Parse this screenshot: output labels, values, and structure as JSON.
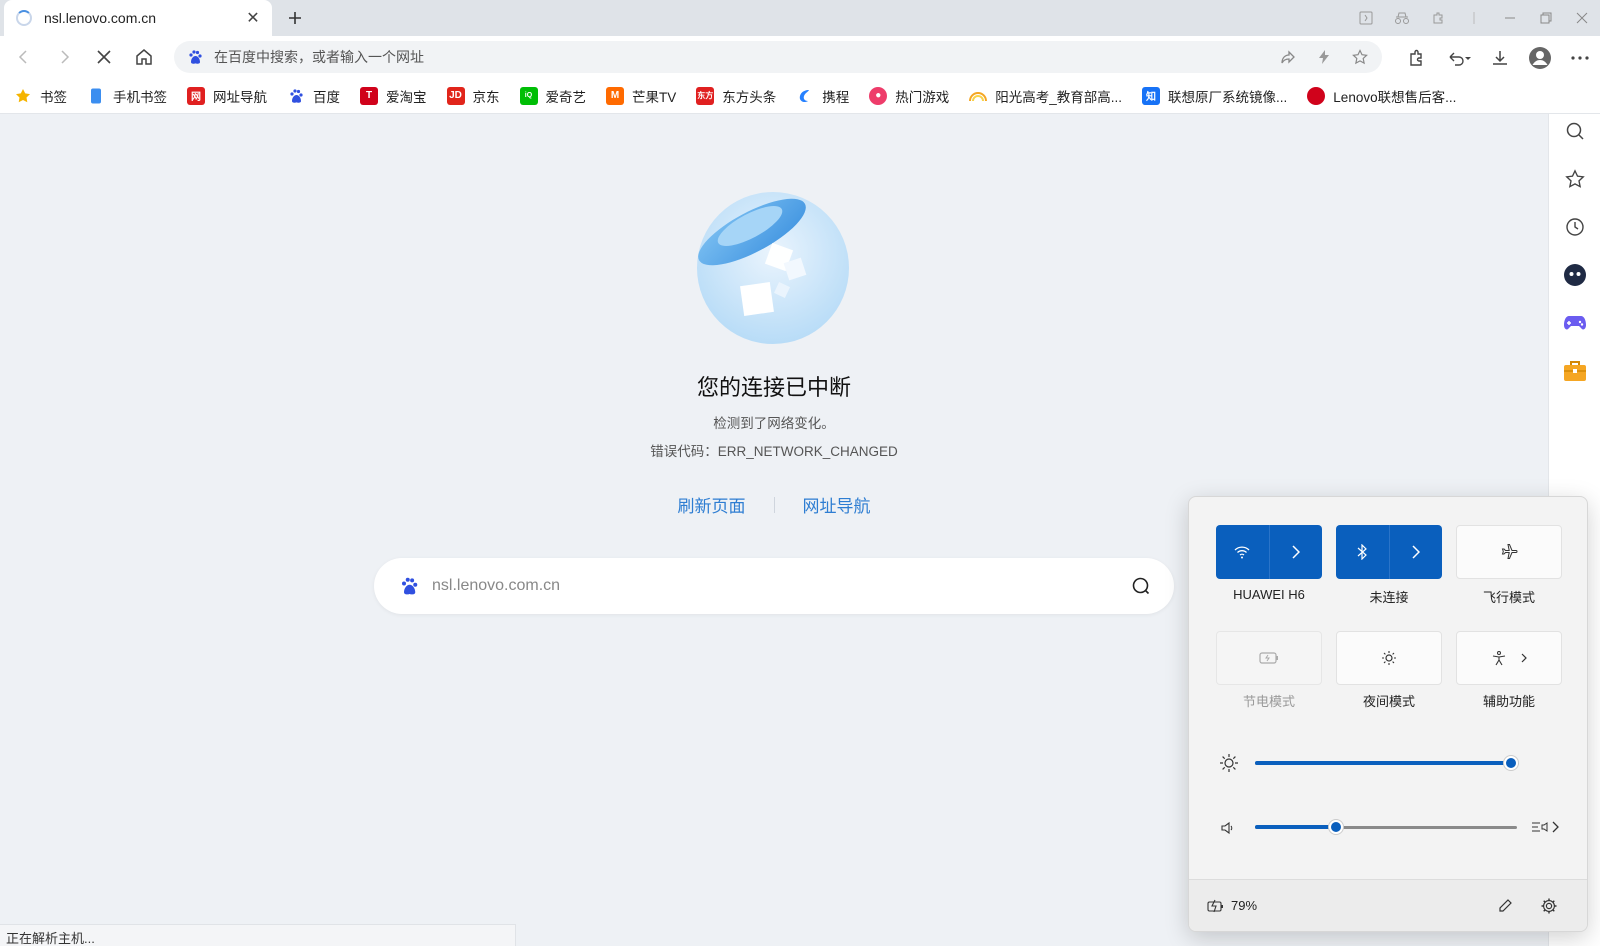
{
  "tab": {
    "title": "nsl.lenovo.com.cn",
    "loading": true
  },
  "toolbar": {
    "omnibox_placeholder": "在百度中搜索，或者输入一个网址"
  },
  "bookmarks": [
    {
      "label": "书签",
      "icon": "star-icon",
      "color": "#f5b400"
    },
    {
      "label": "手机书签",
      "icon": "phone-icon",
      "color": "#3b8ef0"
    },
    {
      "label": "网址导航",
      "icon": "nav-icon",
      "color": "#e02020"
    },
    {
      "label": "百度",
      "icon": "baidu-paw-icon",
      "color": "#3050e0"
    },
    {
      "label": "爱淘宝",
      "icon": "taobao-icon",
      "color": "#d0021b"
    },
    {
      "label": "京东",
      "icon": "jd-icon",
      "color": "#e1251b"
    },
    {
      "label": "爱奇艺",
      "icon": "iqiyi-icon",
      "color": "#00be06"
    },
    {
      "label": "芒果TV",
      "icon": "mango-icon",
      "color": "#ff6a00"
    },
    {
      "label": "东方头条",
      "icon": "dftt-icon",
      "color": "#e02020"
    },
    {
      "label": "携程",
      "icon": "ctrip-icon",
      "color": "#2681ff"
    },
    {
      "label": "热门游戏",
      "icon": "game-icon",
      "color": "#ee3c6a"
    },
    {
      "label": "阳光高考_教育部高...",
      "icon": "rainbow-icon",
      "color": "#f5a623"
    },
    {
      "label": "联想原厂系统镜像...",
      "icon": "zhihu-icon",
      "color": "#1772f6"
    },
    {
      "label": "Lenovo联想售后客...",
      "icon": "lenovo-icon",
      "color": "#d0021b"
    }
  ],
  "error": {
    "title": "您的连接已中断",
    "description": "检测到了网络变化。",
    "code": "错误代码：ERR_NETWORK_CHANGED",
    "refresh_link": "刷新页面",
    "nav_link": "网址导航",
    "search_value": "nsl.lenovo.com.cn"
  },
  "status_bar": "正在解析主机...",
  "quick_settings": {
    "tiles": [
      {
        "label": "HUAWEI H6",
        "icon": "wifi-icon",
        "state": "on"
      },
      {
        "label": "未连接",
        "icon": "bluetooth-icon",
        "state": "on"
      },
      {
        "label": "飞行模式",
        "icon": "airplane-icon",
        "state": "off"
      },
      {
        "label": "节电模式",
        "icon": "battery-saver-icon",
        "state": "disabled"
      },
      {
        "label": "夜间模式",
        "icon": "night-light-icon",
        "state": "off"
      },
      {
        "label": "辅助功能",
        "icon": "accessibility-icon",
        "state": "off"
      }
    ],
    "brightness": 0.97,
    "volume": 0.31,
    "battery": "79%"
  },
  "colors": {
    "accent": "#0a5fbd",
    "link": "#2d7dd2",
    "page_bg": "#eef1f5"
  }
}
